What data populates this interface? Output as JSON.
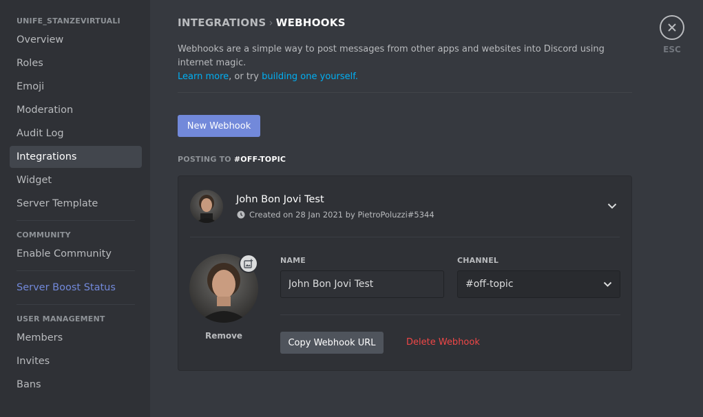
{
  "sidebar": {
    "server_header": "UNIFE_STANZEVIRTUALI",
    "server_items": [
      "Overview",
      "Roles",
      "Emoji",
      "Moderation",
      "Audit Log",
      "Integrations",
      "Widget",
      "Server Template"
    ],
    "active_item": "Integrations",
    "community_header": "COMMUNITY",
    "community_items": [
      "Enable Community"
    ],
    "boost_label": "Server Boost Status",
    "user_mgmt_header": "USER MANAGEMENT",
    "user_mgmt_items": [
      "Members",
      "Invites",
      "Bans"
    ]
  },
  "breadcrumb": {
    "parent": "INTEGRATIONS",
    "separator": "›",
    "current": "WEBHOOKS"
  },
  "description": {
    "text": "Webhooks are a simple way to post messages from other apps and websites into Discord using internet magic.",
    "learn_more": "Learn more",
    "or_try": ", or try ",
    "build_link": "building one yourself."
  },
  "new_webhook_button": "New Webhook",
  "posting": {
    "prefix": "POSTING TO ",
    "channel": "#OFF-TOPIC"
  },
  "webhook": {
    "name": "John Bon Jovi Test",
    "created_text": "Created on 28 Jan 2021 by PietroPoluzzi#5344",
    "remove_label": "Remove",
    "name_label": "NAME",
    "name_value": "John Bon Jovi Test",
    "channel_label": "CHANNEL",
    "channel_value": "#off-topic",
    "copy_url_label": "Copy Webhook URL",
    "delete_label": "Delete Webhook"
  },
  "close": {
    "label": "ESC",
    "icon": "close-icon"
  },
  "colors": {
    "accent": "#7289da",
    "danger": "#f04747",
    "link": "#00b0f4",
    "background": "#36393f",
    "sidebar": "#2f3136"
  }
}
